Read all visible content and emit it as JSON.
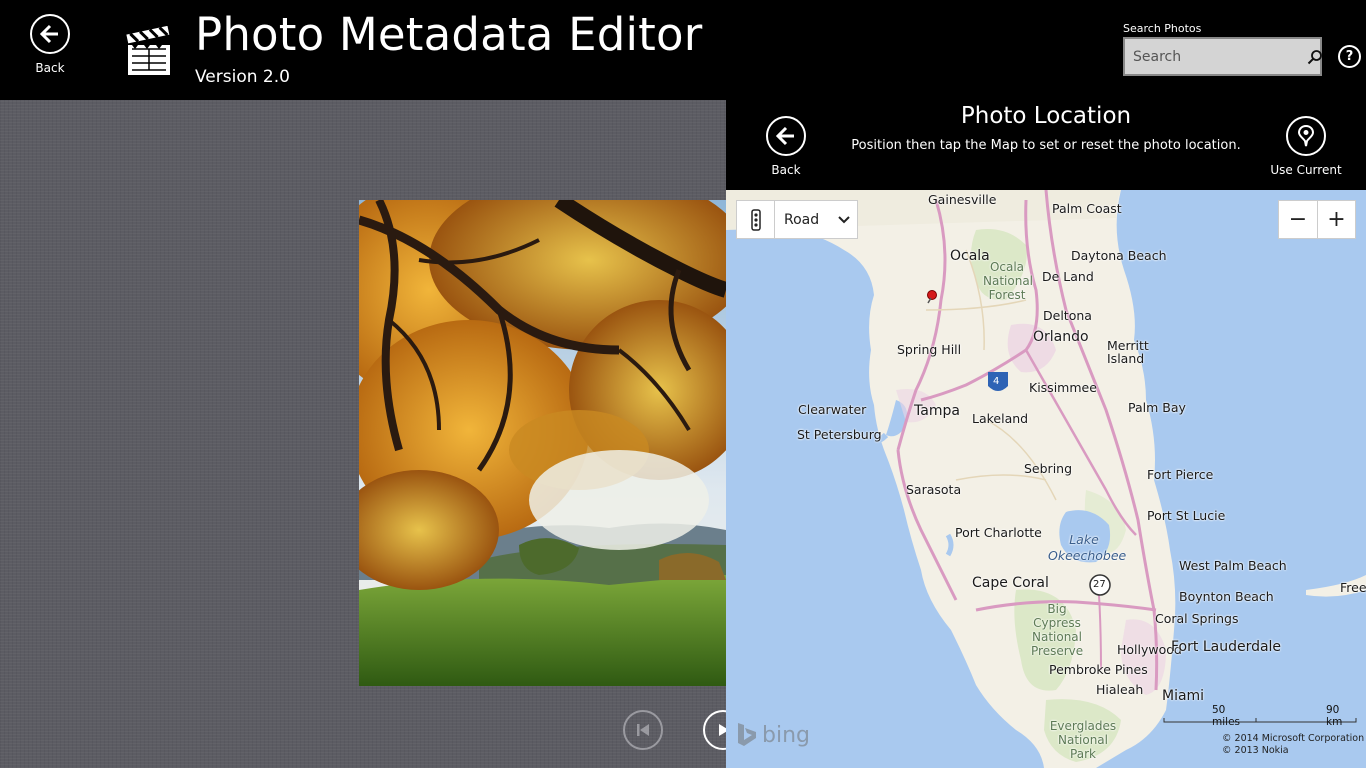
{
  "app": {
    "back_label": "Back",
    "title": "Photo Metadata Editor",
    "version": "Version 2.0",
    "search_label": "Search Photos",
    "search_placeholder": "Search",
    "help_label": "?"
  },
  "flyout": {
    "title": "Photo Location",
    "instructions": "Position then tap the Map to set or reset the photo location.",
    "back_label": "Back",
    "use_current_label": "Use Current"
  },
  "map": {
    "style_selected": "Road",
    "zoom_out_label": "−",
    "zoom_in_label": "+",
    "scale_miles": "50 miles",
    "scale_km": "90 km",
    "brand": "bing",
    "copyright_1": "© 2014 Microsoft Corporation",
    "copyright_2": "© 2013 Nokia",
    "labels": {
      "gainesville": "Gainesville",
      "palm_coast": "Palm Coast",
      "ocala": "Ocala",
      "ocala_nf": "Ocala National Forest",
      "daytona": "Daytona Beach",
      "deland": "De Land",
      "deltona": "Deltona",
      "orlando": "Orlando",
      "merritt": "Merritt Island",
      "spring_hill": "Spring Hill",
      "kissimmee": "Kissimmee",
      "clearwater": "Clearwater",
      "tampa": "Tampa",
      "lakeland": "Lakeland",
      "palm_bay": "Palm Bay",
      "st_pete": "St Petersburg",
      "sebring": "Sebring",
      "fort_pierce": "Fort Pierce",
      "sarasota": "Sarasota",
      "port_st_lucie": "Port St Lucie",
      "port_charlotte": "Port Charlotte",
      "lake_o": "Lake Okeechobee",
      "wpb": "West Palm Beach",
      "cape_coral": "Cape Coral",
      "freeport": "Freep",
      "boynton": "Boynton Beach",
      "big_cypress": "Big Cypress National Preserve",
      "coral_springs": "Coral Springs",
      "hollywood": "Hollywood",
      "fort_lauderdale": "Fort Lauderdale",
      "pembroke": "Pembroke Pines",
      "hialeah": "Hialeah",
      "miami": "Miami",
      "everglades": "Everglades National Park",
      "i4": "4",
      "us27": "27"
    }
  }
}
